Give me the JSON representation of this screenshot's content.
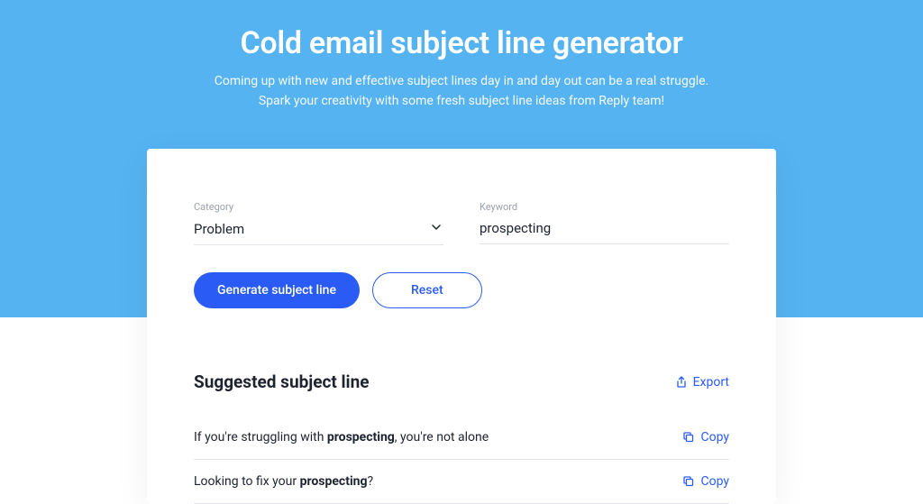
{
  "hero": {
    "title": "Cold email subject line generator",
    "subtitle_line1": "Coming up with new and effective subject lines day in and day out can be a real struggle.",
    "subtitle_line2": "Spark your creativity with some fresh subject line ideas from Reply team!"
  },
  "form": {
    "category_label": "Category",
    "category_value": "Problem",
    "keyword_label": "Keyword",
    "keyword_value": "prospecting",
    "generate_label": "Generate subject line",
    "reset_label": "Reset"
  },
  "results": {
    "heading": "Suggested subject line",
    "export_label": "Export",
    "copy_label": "Copy",
    "items": [
      {
        "prefix": "If you're struggling with ",
        "bold": "prospecting",
        "suffix": ", you're not alone"
      },
      {
        "prefix": "Looking to fix your ",
        "bold": "prospecting",
        "suffix": "?"
      }
    ]
  }
}
